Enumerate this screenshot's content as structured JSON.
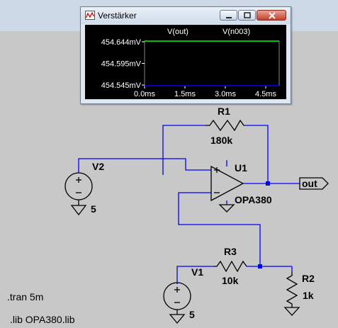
{
  "plot_window": {
    "title": "Verstärker",
    "icon": "waveform-icon",
    "controls": {
      "minimize": "minimize-icon",
      "maximize": "maximize-icon",
      "close": "close-icon"
    },
    "trace_labels": [
      "V(out)",
      "V(n003)"
    ],
    "trace_colors": [
      "#00ff00",
      "#0000ff"
    ],
    "y_ticks": [
      "454.644mV",
      "454.595mV",
      "454.545mV"
    ],
    "x_ticks": [
      "0.0ms",
      "1.5ms",
      "3.0ms",
      "4.5ms"
    ]
  },
  "chart_data": {
    "type": "line",
    "x": [
      0.0,
      5.0
    ],
    "xlabel": "",
    "ylabel": "",
    "xlim": [
      0.0,
      5.0
    ],
    "ylim": [
      454.545,
      454.644
    ],
    "series": [
      {
        "name": "V(out)",
        "values": [
          454.644,
          454.644
        ]
      },
      {
        "name": "V(n003)",
        "values": [
          454.545,
          454.545
        ]
      }
    ]
  },
  "schematic": {
    "r1": {
      "name": "R1",
      "value": "180k"
    },
    "r2": {
      "name": "R2",
      "value": "1k"
    },
    "r3": {
      "name": "R3",
      "value": "10k"
    },
    "v1": {
      "name": "V1",
      "value": "5"
    },
    "v2": {
      "name": "V2",
      "value": "5"
    },
    "u1": {
      "name": "U1",
      "value": "OPA380"
    },
    "out_label": "out",
    "directives": [
      ".tran 5m",
      ".lib OPA380.lib"
    ],
    "colors": {
      "wire": "#0000ff",
      "component": "#000000",
      "junction": "#0000ff"
    }
  }
}
